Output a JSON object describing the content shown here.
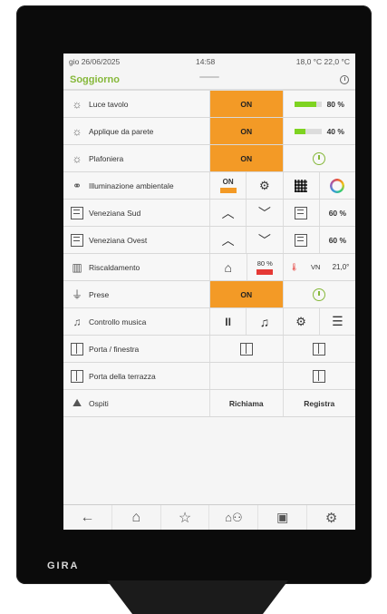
{
  "brand": "GIRA",
  "status": {
    "date": "gio 26/06/2025",
    "time": "14:58",
    "temperatures": "18,0 °C  22,0 °C"
  },
  "room": {
    "title": "Soggiorno"
  },
  "rows": [
    {
      "name": "Luce tavolo",
      "state": "ON",
      "value": "80 %",
      "level": 0.8
    },
    {
      "name": "Applique da parete",
      "state": "ON",
      "value": "40 %",
      "level": 0.4
    },
    {
      "name": "Plafoniera",
      "state": "ON"
    },
    {
      "name": "Illuminazione ambientale",
      "state": "ON"
    },
    {
      "name": "Veneziana Sud",
      "value": "60 %"
    },
    {
      "name": "Veneziana Ovest",
      "value": "60 %"
    },
    {
      "name": "Riscaldamento",
      "value": "80 %",
      "mode": "VN",
      "temp": "21,0°"
    },
    {
      "name": "Prese",
      "state": "ON"
    },
    {
      "name": "Controllo musica"
    },
    {
      "name": "Porta / finestra"
    },
    {
      "name": "Porta della terrazza"
    },
    {
      "name": "Ospiti",
      "recall": "Richiama",
      "save": "Registra"
    }
  ],
  "accent": "#f39a26",
  "title_color": "#86b83a",
  "nav": [
    "back-arrow-icon",
    "home-icon",
    "star-icon",
    "house-person-icon",
    "car-icon",
    "settings-icon"
  ]
}
